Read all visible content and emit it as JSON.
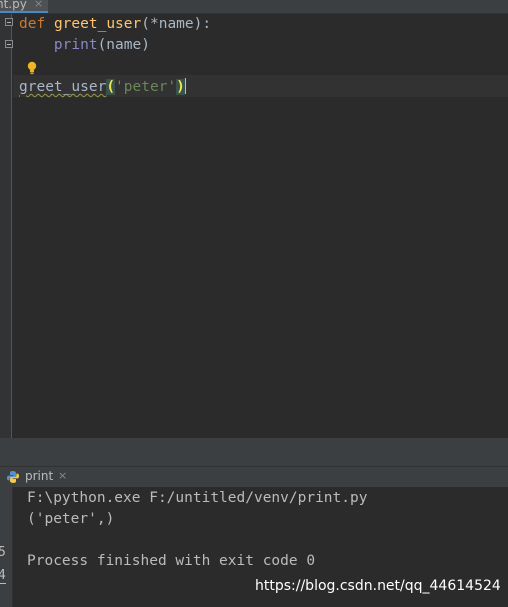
{
  "editor_tab": {
    "filename": "nt.py",
    "close_glyph": "×"
  },
  "code": {
    "line1": {
      "kw": "def",
      "fn": "greet_user",
      "rest": "(*name):"
    },
    "line2": {
      "indent": "    ",
      "builtin": "print",
      "rest": "(name)"
    },
    "line4": {
      "call": "greet_user",
      "open": "(",
      "arg": "'peter'",
      "close": ")"
    }
  },
  "intention_icon": "lightbulb-icon",
  "run_panel": {
    "tab_label": "print",
    "close_glyph": "×",
    "icon": "python-icon"
  },
  "console": {
    "lines": [
      "F:\\python.exe F:/untitled/venv/print.py",
      "('peter',)",
      "",
      "Process finished with exit code 0"
    ],
    "gutter_glyphs": [
      "5",
      "4"
    ]
  },
  "watermark": "https://blog.csdn.net/qq_44614524",
  "colors": {
    "background": "#2b2b2b",
    "keyword": "#cc7832",
    "function": "#ffc66d",
    "builtin": "#8888c6",
    "string": "#6a8759",
    "text": "#a9b7c6"
  }
}
